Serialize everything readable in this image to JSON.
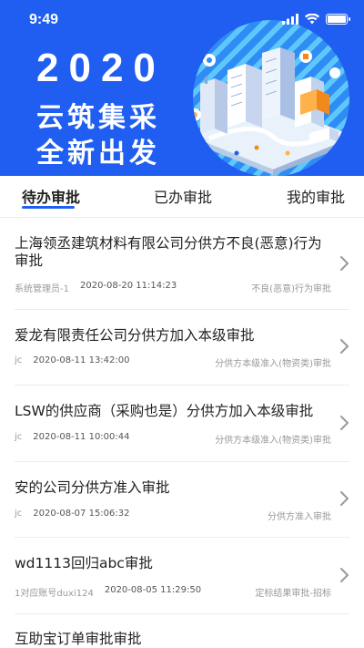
{
  "status_bar": {
    "time": "9:49"
  },
  "banner": {
    "year": "2020",
    "line1": "云筑集采",
    "line2": "全新出发"
  },
  "tabs": [
    {
      "label": "待办审批",
      "active": true
    },
    {
      "label": "已办审批",
      "active": false
    },
    {
      "label": "我的审批",
      "active": false
    }
  ],
  "approvals": [
    {
      "title": "上海领丞建筑材料有限公司分供方不良(恶意)行为审批",
      "user": "系统管理员-1",
      "time": "2020-08-20 11:14:23",
      "type": "不良(恶意)行为审批"
    },
    {
      "title": "爱龙有限责任公司分供方加入本级审批",
      "user": "jc",
      "time": "2020-08-11 13:42:00",
      "type": "分供方本级准入(物资类)审批"
    },
    {
      "title": "LSW的供应商（采购也是）分供方加入本级审批",
      "user": "jc",
      "time": "2020-08-11 10:00:44",
      "type": "分供方本级准入(物资类)审批"
    },
    {
      "title": "安的公司分供方准入审批",
      "user": "jc",
      "time": "2020-08-07 15:06:32",
      "type": "分供方准入审批"
    },
    {
      "title": "wd1113回归abc审批",
      "user": "1对应账号duxi124",
      "time": "2020-08-05 11:29:50",
      "type": "定标结果审批-招标"
    },
    {
      "title": "互助宝订单审批审批",
      "user": "",
      "time": "",
      "type": ""
    }
  ]
}
